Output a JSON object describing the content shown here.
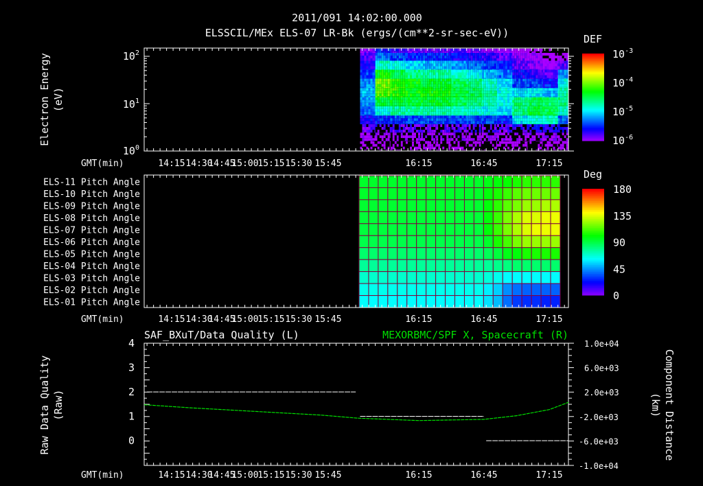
{
  "header": {
    "datetime": "2011/091 14:02:00.000",
    "title": "ELSSCIL/MEx ELS-07 LR-Bk  (ergs/(cm**2-sr-sec-eV))"
  },
  "time_axis_label": "GMT(min)",
  "time_tick_labels": [
    "14:15",
    "14:30",
    "14:45",
    "15:00",
    "15:15",
    "15:30",
    "15:45",
    "16:15",
    "16:45",
    "17:15"
  ],
  "chart_data": [
    {
      "type": "heatmap",
      "title": "ELSSCIL/MEx ELS-07 LR-Bk  (ergs/(cm**2-sr-sec-eV))",
      "ylabel": [
        "Electron Energy",
        "(eV)"
      ],
      "xlabel": "GMT(min)",
      "yscale": "log",
      "ylim": [
        1,
        150
      ],
      "y_tick_labels": [
        {
          "base": "10",
          "exp": "0"
        },
        {
          "base": "10",
          "exp": "1"
        },
        {
          "base": "10",
          "exp": "2"
        }
      ],
      "colorbar": {
        "label": "DEF",
        "scale": "log",
        "range": [
          1e-06,
          0.001
        ],
        "tick_labels": [
          {
            "base": "10",
            "exp": "-3"
          },
          {
            "base": "10",
            "exp": "-4"
          },
          {
            "base": "10",
            "exp": "-5"
          },
          {
            "base": "10",
            "exp": "-6"
          }
        ]
      },
      "times": [
        "15:48",
        "15:55",
        "16:02",
        "16:09",
        "16:16",
        "16:23",
        "16:30",
        "16:37",
        "16:44",
        "16:51",
        "16:58",
        "17:05",
        "17:12",
        "17:19"
      ],
      "energies_eV": [
        1.3,
        2,
        3,
        4.5,
        7,
        11,
        17,
        27,
        42,
        65,
        100,
        140
      ],
      "log10_def": [
        [
          -6.2,
          -6,
          -5.8,
          -5.6,
          -5.3,
          -5.2,
          -5.1,
          -5.2,
          -5.4,
          -5.6,
          -5.8,
          -5.9
        ],
        [
          -6.2,
          -6,
          -5.8,
          -5.5,
          -4.9,
          -4.4,
          -4.1,
          -4.0,
          -4.3,
          -4.8,
          -5.3,
          -5.5
        ],
        [
          -6.2,
          -6,
          -5.8,
          -5.4,
          -4.7,
          -4.4,
          -4.2,
          -4.2,
          -4.5,
          -4.9,
          -5.4,
          -5.7
        ],
        [
          -6.2,
          -6,
          -5.8,
          -5.4,
          -4.7,
          -4.4,
          -4.3,
          -4.3,
          -4.6,
          -5.0,
          -5.5,
          -5.8
        ],
        [
          -6.2,
          -6,
          -5.8,
          -5.4,
          -4.7,
          -4.4,
          -4.3,
          -4.4,
          -4.7,
          -5.1,
          -5.5,
          -5.8
        ],
        [
          -6.2,
          -6,
          -5.8,
          -5.4,
          -4.7,
          -4.4,
          -4.3,
          -4.4,
          -4.7,
          -5.1,
          -5.5,
          -5.8
        ],
        [
          -6.2,
          -6,
          -5.8,
          -5.4,
          -4.8,
          -4.5,
          -4.4,
          -4.5,
          -4.8,
          -5.2,
          -5.6,
          -5.8
        ],
        [
          -6.2,
          -6,
          -5.8,
          -5.4,
          -4.8,
          -4.6,
          -4.5,
          -4.6,
          -4.9,
          -5.3,
          -5.6,
          -5.9
        ],
        [
          -6.2,
          -6,
          -5.8,
          -5.4,
          -4.9,
          -4.7,
          -4.7,
          -4.8,
          -5.1,
          -5.4,
          -5.7,
          -5.9
        ],
        [
          -6.2,
          -6,
          -5.8,
          -5.5,
          -5.0,
          -4.9,
          -4.9,
          -5.0,
          -5.3,
          -5.5,
          -5.8,
          -6.0
        ],
        [
          -6.2,
          -6,
          -5.7,
          -5.0,
          -4.6,
          -4.6,
          -5.0,
          -5.4,
          -5.6,
          -5.8,
          -5.9,
          -6.1
        ],
        [
          -6.2,
          -6,
          -5.6,
          -4.8,
          -4.4,
          -4.5,
          -5.0,
          -5.4,
          -5.7,
          -5.9,
          -6.0,
          -6.2
        ],
        [
          -6.2,
          -6,
          -5.6,
          -4.8,
          -4.5,
          -4.6,
          -5.1,
          -5.5,
          -5.8,
          -6.0,
          -6.2,
          -6.4
        ],
        [
          -6.2,
          -6,
          -5.7,
          -5.3,
          -4.8,
          -4.6,
          -4.7,
          -4.9,
          -5.2,
          -5.8,
          -6.2,
          -6.4
        ]
      ]
    },
    {
      "type": "heatmap",
      "xlabel": "GMT(min)",
      "row_labels": [
        "ELS-11 Pitch Angle",
        "ELS-10 Pitch Angle",
        "ELS-09 Pitch Angle",
        "ELS-08 Pitch Angle",
        "ELS-07 Pitch Angle",
        "ELS-06 Pitch Angle",
        "ELS-05 Pitch Angle",
        "ELS-04 Pitch Angle",
        "ELS-03 Pitch Angle",
        "ELS-02 Pitch Angle",
        "ELS-01 Pitch Angle"
      ],
      "colorbar": {
        "label": "Deg",
        "range": [
          0,
          180
        ],
        "tick_labels": [
          "180",
          "135",
          "90",
          "45",
          "0"
        ]
      },
      "time_start": "15:47",
      "time_end": "17:24",
      "values_deg": [
        [
          95,
          95,
          95,
          95,
          95,
          95,
          95,
          95,
          95,
          95,
          95,
          95,
          95,
          98,
          100,
          102,
          105,
          108,
          108,
          108,
          108
        ],
        [
          95,
          95,
          95,
          95,
          95,
          95,
          95,
          95,
          95,
          95,
          95,
          95,
          95,
          100,
          105,
          110,
          115,
          118,
          118,
          118,
          118
        ],
        [
          94,
          94,
          94,
          94,
          94,
          94,
          94,
          94,
          94,
          94,
          94,
          94,
          94,
          100,
          108,
          115,
          120,
          125,
          125,
          128,
          128
        ],
        [
          93,
          93,
          93,
          93,
          93,
          93,
          93,
          93,
          93,
          93,
          93,
          93,
          93,
          100,
          110,
          120,
          128,
          135,
          135,
          138,
          138
        ],
        [
          92,
          92,
          92,
          92,
          92,
          92,
          92,
          92,
          92,
          92,
          92,
          92,
          92,
          100,
          110,
          120,
          128,
          135,
          138,
          138,
          138
        ],
        [
          90,
          90,
          90,
          90,
          90,
          90,
          90,
          90,
          90,
          90,
          90,
          90,
          90,
          95,
          105,
          112,
          120,
          125,
          125,
          125,
          125
        ],
        [
          85,
          85,
          85,
          85,
          85,
          85,
          85,
          85,
          85,
          85,
          85,
          85,
          85,
          88,
          92,
          98,
          100,
          105,
          105,
          105,
          105
        ],
        [
          78,
          78,
          78,
          78,
          78,
          78,
          78,
          78,
          78,
          78,
          78,
          78,
          78,
          78,
          80,
          82,
          85,
          85,
          85,
          85,
          85
        ],
        [
          70,
          70,
          70,
          70,
          70,
          70,
          70,
          70,
          70,
          70,
          70,
          70,
          70,
          68,
          65,
          62,
          62,
          62,
          62,
          62,
          62
        ],
        [
          65,
          65,
          65,
          65,
          65,
          65,
          65,
          65,
          65,
          65,
          65,
          65,
          65,
          60,
          55,
          45,
          40,
          38,
          38,
          38,
          38
        ],
        [
          62,
          62,
          62,
          62,
          62,
          62,
          62,
          62,
          62,
          62,
          62,
          62,
          62,
          58,
          52,
          40,
          32,
          30,
          30,
          28,
          28
        ]
      ]
    },
    {
      "type": "line",
      "left_title": "SAF_BXuT/Data Quality (L)",
      "right_title": "MEXORBMC/SPF X, Spacecraft (R)",
      "ylabel_left": [
        "Raw Data Quality",
        "(Raw)"
      ],
      "ylabel_right": [
        "Component Distance",
        "(km)"
      ],
      "xlabel": "GMT(min)",
      "ylim_left": [
        -1,
        4
      ],
      "ylim_right": [
        -10000,
        10000
      ],
      "y_tick_labels_left": [
        "4",
        "3",
        "2",
        "1",
        "0"
      ],
      "y_tick_labels_right": [
        "1.0e+04",
        "6.0e+03",
        "2.0e+03",
        "-2.0e+03",
        "-6.0e+03",
        "-1.0e+04"
      ],
      "series": [
        {
          "axis": "left",
          "color": "#ffffff",
          "segments": [
            {
              "start": "14:10",
              "end": "15:46",
              "value": 2
            },
            {
              "start": "15:48",
              "end": "16:45",
              "value": 1
            },
            {
              "start": "16:46",
              "end": "17:24",
              "value": 0
            }
          ]
        },
        {
          "axis": "right",
          "color": "#00e000",
          "x": [
            "14:08",
            "14:30",
            "15:00",
            "15:30",
            "15:47",
            "16:15",
            "16:45",
            "17:00",
            "17:15",
            "17:27"
          ],
          "y": [
            -100,
            -600,
            -1200,
            -1800,
            -2300,
            -2700,
            -2500,
            -1900,
            -900,
            300
          ]
        }
      ]
    }
  ],
  "colors": {
    "background": "#000000",
    "axis": "#ffffff",
    "right_series": "#00e000",
    "grid": "#800040"
  }
}
